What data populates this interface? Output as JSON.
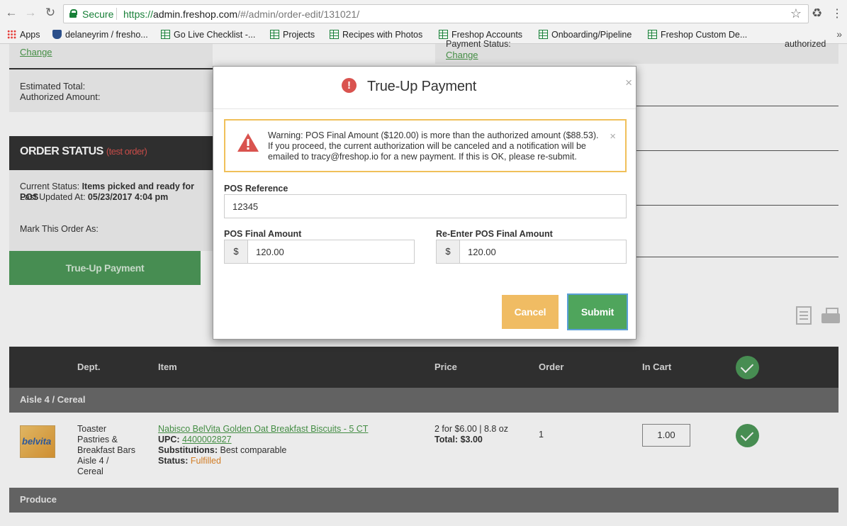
{
  "browser": {
    "secure_label": "Secure",
    "url_proto": "https://",
    "url_host": "admin.freshop.com",
    "url_rest": "/#/admin/order-edit/131021/",
    "bookmarks": [
      {
        "label": "Apps",
        "icon": "apps-grid-icon"
      },
      {
        "label": "delaneyrim / fresho...",
        "icon": "shield-icon"
      },
      {
        "label": "Go Live Checklist -...",
        "icon": "spreadsheet-icon"
      },
      {
        "label": "Projects",
        "icon": "spreadsheet-icon"
      },
      {
        "label": "Recipes with Photos",
        "icon": "spreadsheet-icon"
      },
      {
        "label": "Freshop Accounts",
        "icon": "spreadsheet-icon"
      },
      {
        "label": "Onboarding/Pipeline",
        "icon": "spreadsheet-icon"
      },
      {
        "label": "Freshop Custom De...",
        "icon": "spreadsheet-icon"
      }
    ],
    "more": "»"
  },
  "order": {
    "change_label": "Change",
    "payment_status_label": "Payment Status:",
    "payment_status_value": "authorized",
    "estimated_total_label": "Estimated Total:",
    "authorized_amount_label": "Authorized Amount:",
    "status_title": "ORDER STATUS",
    "status_test": "(test order)",
    "current_status_label": "Current Status:",
    "current_status_value": "Items picked and ready for POS",
    "last_updated_label": "Last Updated At:",
    "last_updated_value": "05/23/2017 4:04 pm",
    "mark_as_label": "Mark This Order As:",
    "true_up_button": "True-Up Payment"
  },
  "table": {
    "headers": [
      "Dept.",
      "Item",
      "Price",
      "Order",
      "In Cart"
    ],
    "sections": [
      "Aisle 4 / Cereal",
      "Produce"
    ],
    "item": {
      "image_text": "belvita",
      "dept": [
        "Toaster",
        "Pastries &",
        "Breakfast Bars",
        "Aisle 4 /",
        "Cereal"
      ],
      "name": "Nabisco BelVita Golden Oat Breakfast Biscuits - 5 CT",
      "upc_label": "UPC:",
      "upc_value": "4400002827",
      "subs_label": "Substitutions:",
      "subs_value": "Best comparable",
      "status_label": "Status:",
      "status_value": "Fulfilled",
      "price_line": "2 for $6.00 | 8.8 oz",
      "total_label": "Total:",
      "total_value": "$3.00",
      "order_qty": "1",
      "cart_qty": "1.00"
    }
  },
  "modal": {
    "title": "True-Up Payment",
    "close": "×",
    "warning_line1": "Warning: POS Final Amount ($120.00) is more than the authorized amount ($88.53).",
    "warning_line2": "If you proceed, the current authorization will be canceled and a notification will be",
    "warning_line3": "emailed to tracy@freshop.io for a new payment. If this is OK, please re-submit.",
    "warning_close": "×",
    "pos_reference_label": "POS Reference",
    "pos_reference_value": "12345",
    "pos_final_label": "POS Final Amount",
    "pos_final_value": "120.00",
    "reenter_label": "Re-Enter POS Final Amount",
    "reenter_value": "120.00",
    "currency": "$",
    "cancel_label": "Cancel",
    "submit_label": "Submit"
  },
  "colors": {
    "accent_green": "#4e9a5a",
    "warning_orange": "#e4892a",
    "error_red": "#d9534f",
    "cancel_yellow": "#f0bc63"
  }
}
